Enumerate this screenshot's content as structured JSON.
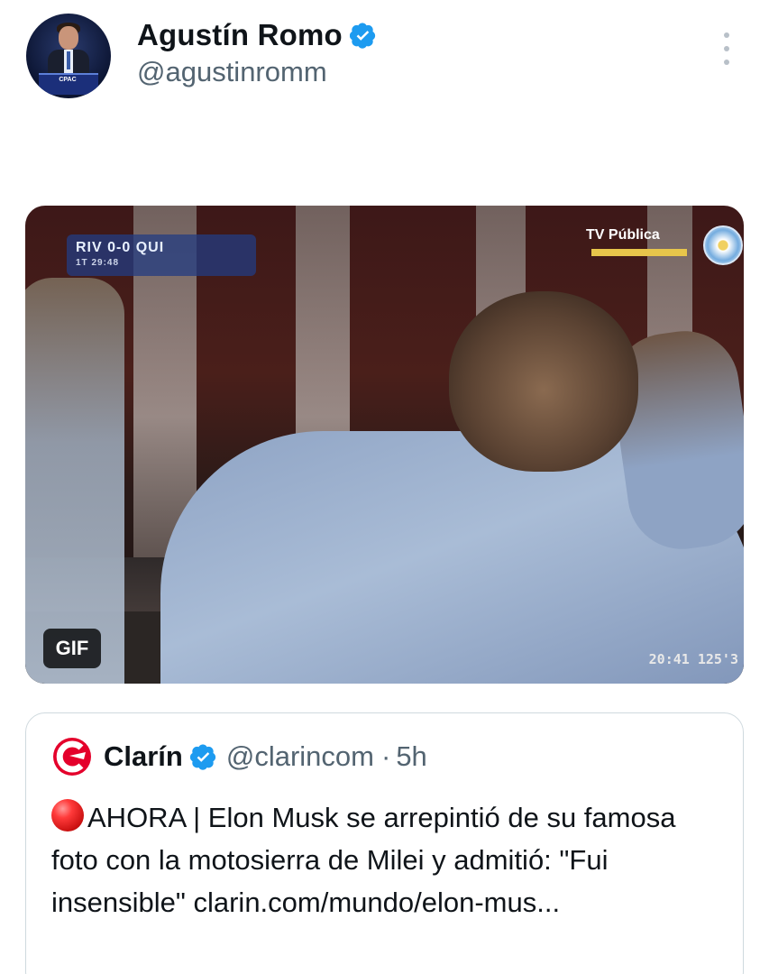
{
  "author": {
    "display_name": "Agustín Romo",
    "handle": "@agustinromm",
    "verified": true,
    "avatar_podium_text": "CPAC"
  },
  "colors": {
    "verified_blue": "#1d9bf0",
    "text_primary": "#0f1419",
    "text_secondary": "#536471",
    "border": "#cfd9de"
  },
  "media": {
    "badge": "GIF",
    "scoreboard": {
      "home": "RIV",
      "score": "0-0",
      "away": "QUI",
      "clock": "1T 29:48"
    },
    "channel": "TV Pública",
    "timestamp": "20:41 125'3"
  },
  "quoted_tweet": {
    "name": "Clarín",
    "handle": "@clarincom",
    "separator": "·",
    "time": "5h",
    "verified": true,
    "text": "AHORA | Elon Musk se arrepintió de su famosa foto con la motosierra de Milei y admitió: \"Fui insensible\" clarin.com/mundo/elon-mus...",
    "leading_icon": "red-circle-icon"
  }
}
